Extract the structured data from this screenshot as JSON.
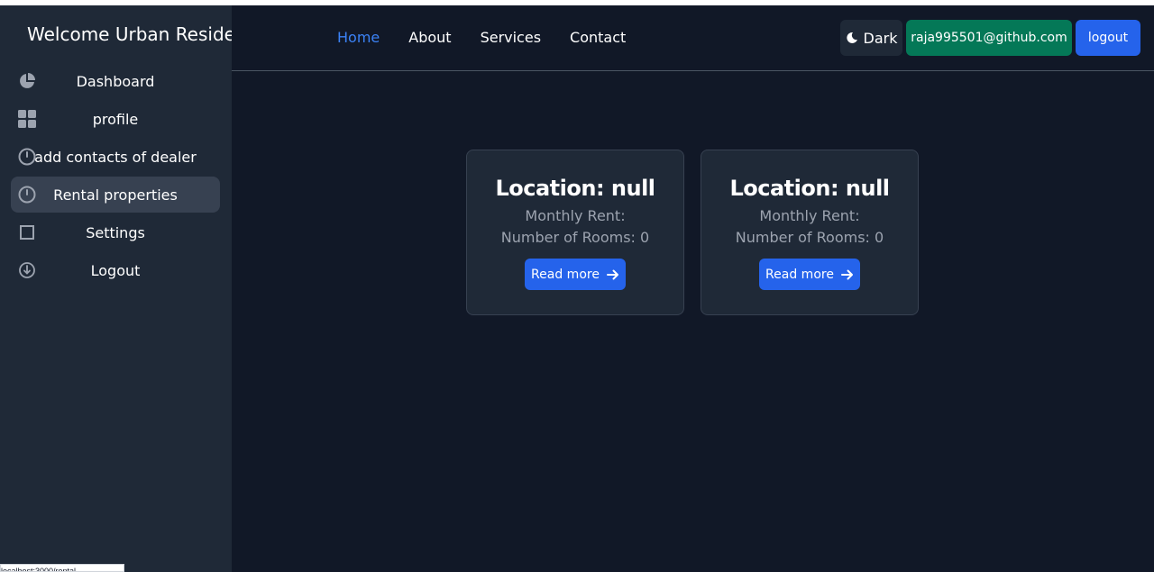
{
  "sidebar": {
    "title": "Welcome Urban Resident",
    "items": [
      {
        "label": "Dashboard",
        "icon": "pie-chart-icon"
      },
      {
        "label": "profile",
        "icon": "grid-icon"
      },
      {
        "label": "add contacts of dealer",
        "icon": "clock-icon"
      },
      {
        "label": "Rental properties",
        "icon": "clock-icon",
        "active": true
      },
      {
        "label": "Settings",
        "icon": "square-icon"
      },
      {
        "label": "Logout",
        "icon": "arrow-circle-down-icon"
      }
    ]
  },
  "header": {
    "nav": [
      {
        "label": "Home",
        "current": true
      },
      {
        "label": "About"
      },
      {
        "label": "Services"
      },
      {
        "label": "Contact"
      }
    ],
    "theme_label": "Dark",
    "email": "raja995501@github.com",
    "logout_label": "logout"
  },
  "cards": [
    {
      "title": "Location: null",
      "rent": "Monthly Rent:",
      "rooms": "Number of Rooms: 0",
      "button": "Read more"
    },
    {
      "title": "Location: null",
      "rent": "Monthly Rent:",
      "rooms": "Number of Rooms: 0",
      "button": "Read more"
    }
  ],
  "statusbar": {
    "url": "localhost:3000/rental"
  },
  "colors": {
    "sidebar_bg": "#1f2937",
    "page_bg": "#111827",
    "accent": "#2563eb",
    "email_bg": "#047857",
    "nav_current": "#3b82f6"
  }
}
